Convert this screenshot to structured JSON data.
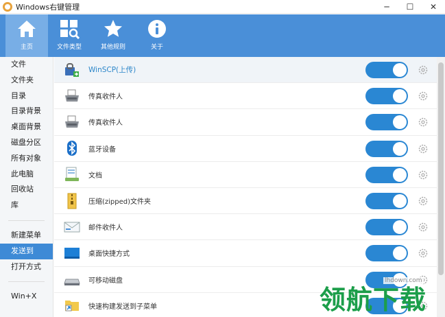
{
  "window": {
    "title": "Windows右键管理",
    "minimize": "─",
    "maximize": "☐",
    "close": "✕"
  },
  "toolbar": {
    "tabs": [
      {
        "label": "主页",
        "icon": "home-icon",
        "active": true
      },
      {
        "label": "文件类型",
        "icon": "file-type-icon",
        "active": false
      },
      {
        "label": "其他规则",
        "icon": "star-icon",
        "active": false
      },
      {
        "label": "关于",
        "icon": "info-icon",
        "active": false
      }
    ]
  },
  "sidebar": {
    "items": [
      {
        "label": "文件"
      },
      {
        "label": "文件夹"
      },
      {
        "label": "目录"
      },
      {
        "label": "目录背景"
      },
      {
        "label": "桌面背景"
      },
      {
        "label": "磁盘分区"
      },
      {
        "label": "所有对象"
      },
      {
        "label": "此电脑"
      },
      {
        "label": "回收站"
      },
      {
        "label": "库"
      }
    ],
    "items2": [
      {
        "label": "新建菜单"
      },
      {
        "label": "发送到",
        "active": true
      },
      {
        "label": "打开方式"
      }
    ],
    "items3": [
      {
        "label": "Win+X"
      }
    ]
  },
  "list": {
    "rows": [
      {
        "label": "WinSCP(上传)",
        "icon": "winscp-icon",
        "enabled": true
      },
      {
        "label": "传真收件人",
        "icon": "fax-icon",
        "enabled": true
      },
      {
        "label": "传真收件人",
        "icon": "fax-icon",
        "enabled": true
      },
      {
        "label": "蓝牙设备",
        "icon": "bluetooth-icon",
        "enabled": true
      },
      {
        "label": "文档",
        "icon": "document-icon",
        "enabled": true
      },
      {
        "label": "压缩(zipped)文件夹",
        "icon": "zip-folder-icon",
        "enabled": true
      },
      {
        "label": "邮件收件人",
        "icon": "mail-icon",
        "enabled": true
      },
      {
        "label": "桌面快捷方式",
        "icon": "desktop-icon",
        "enabled": true
      },
      {
        "label": "可移动磁盘",
        "icon": "removable-disk-icon",
        "enabled": true
      },
      {
        "label": "快速构建发送到子菜单",
        "icon": "folder-shortcut-icon",
        "enabled": true
      }
    ]
  },
  "watermark": {
    "url": "lhdown.com",
    "text": "领航下载"
  },
  "colors": {
    "header": "#4a8fd8",
    "toggle_on": "#2a87d3",
    "sidebar_active": "#3e8ad6"
  }
}
